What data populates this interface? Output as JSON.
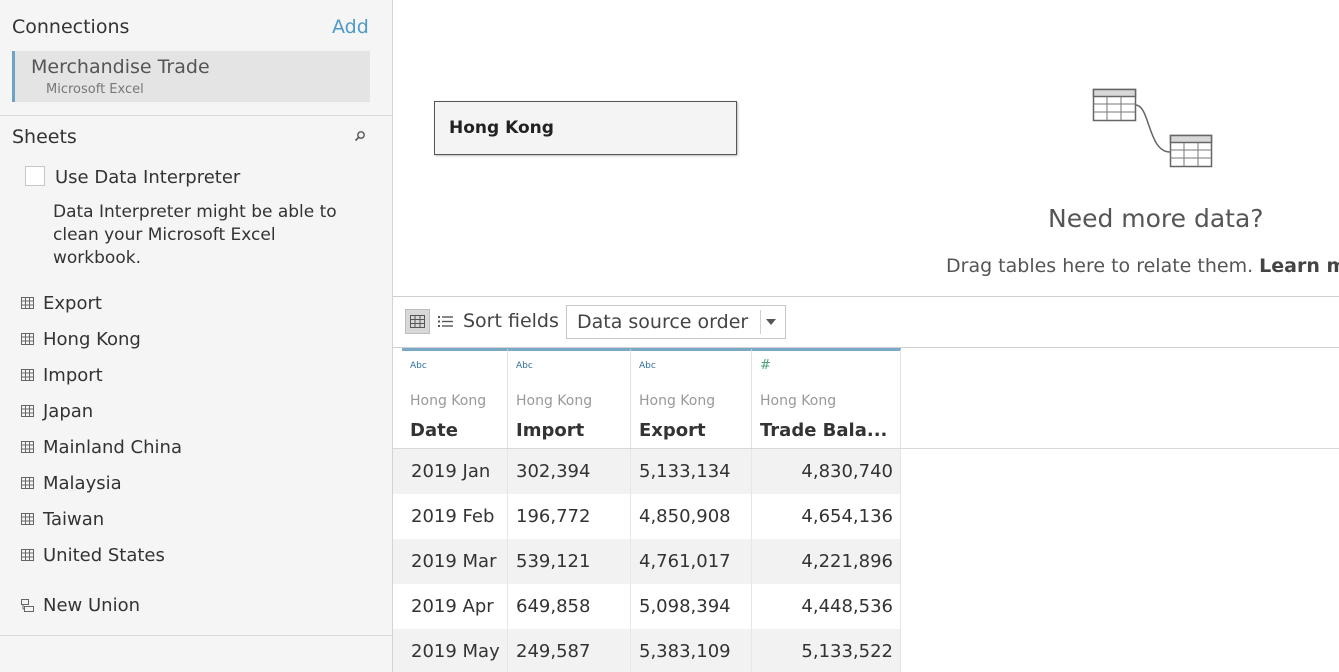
{
  "connections": {
    "title": "Connections",
    "add_label": "Add",
    "items": [
      {
        "name": "Merchandise Trade",
        "type": "Microsoft Excel"
      }
    ]
  },
  "sheets": {
    "title": "Sheets",
    "interpreter_label": "Use Data Interpreter",
    "interpreter_desc": "Data Interpreter might be able to clean your Microsoft Excel workbook.",
    "items": [
      "Export",
      "Hong Kong",
      "Import",
      "Japan",
      "Mainland China",
      "Malaysia",
      "Taiwan",
      "United States"
    ],
    "union_label": "New Union"
  },
  "canvas": {
    "table_node": "Hong Kong",
    "need_more": "Need more data?",
    "drag_hint": "Drag tables here to relate them. ",
    "learn_more": "Learn mo"
  },
  "toolbar": {
    "sort_label": "Sort fields",
    "sort_value": "Data source order"
  },
  "grid": {
    "columns": [
      {
        "type_icon": "Abc",
        "source": "Hong Kong",
        "name": "Date"
      },
      {
        "type_icon": "Abc",
        "source": "Hong Kong",
        "name": "Import"
      },
      {
        "type_icon": "Abc",
        "source": "Hong Kong",
        "name": "Export"
      },
      {
        "type_icon": "#",
        "source": "Hong Kong",
        "name": "Trade Bala..."
      }
    ],
    "rows": [
      [
        "2019 Jan",
        "302,394",
        "5,133,134",
        "4,830,740"
      ],
      [
        "2019 Feb",
        "196,772",
        "4,850,908",
        "4,654,136"
      ],
      [
        "2019 Mar",
        "539,121",
        "4,761,017",
        "4,221,896"
      ],
      [
        "2019 Apr",
        "649,858",
        "5,098,394",
        "4,448,536"
      ],
      [
        "2019 May",
        "249,587",
        "5,383,109",
        "5,133,522"
      ]
    ]
  },
  "colors": {
    "accent": "#4e9bc6",
    "column_header_border": "#7aa8c7",
    "number_type": "#4aa07a"
  }
}
